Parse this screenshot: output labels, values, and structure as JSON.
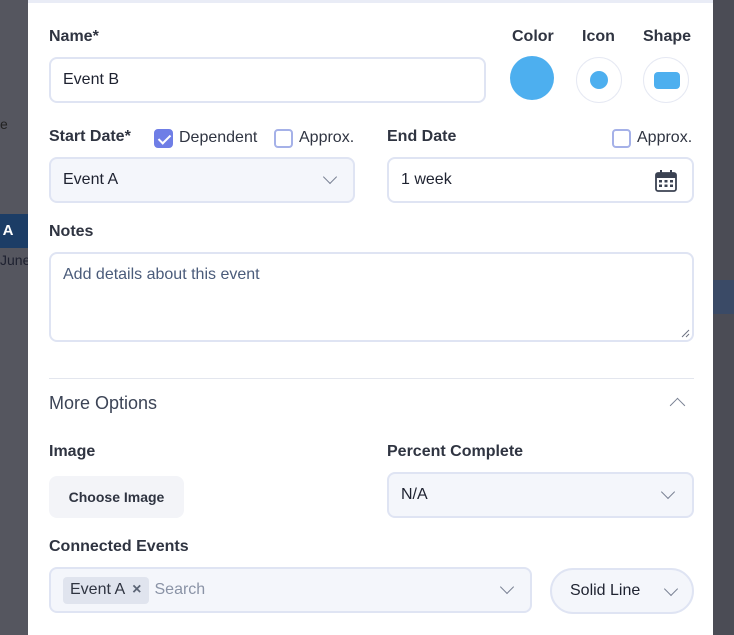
{
  "background": {
    "left_text_1": "e",
    "pill_text": "t A",
    "date_text": "June"
  },
  "form": {
    "name": {
      "label": "Name*",
      "value": "Event B"
    },
    "appearance": {
      "color_label": "Color",
      "icon_label": "Icon",
      "shape_label": "Shape",
      "color_value": "#4dafef"
    },
    "start_date": {
      "label": "Start Date*",
      "dependent_label": "Dependent",
      "dependent_checked": true,
      "approx_label": "Approx.",
      "approx_checked": false,
      "value": "Event A"
    },
    "end_date": {
      "label": "End Date",
      "approx_label": "Approx.",
      "approx_checked": false,
      "value": "1 week"
    },
    "notes": {
      "label": "Notes",
      "placeholder": "Add details about this event"
    },
    "more_options": {
      "title": "More Options",
      "image_label": "Image",
      "choose_image_label": "Choose Image",
      "percent_label": "Percent Complete",
      "percent_value": "N/A",
      "connected_label": "Connected Events",
      "connected_tag": "Event A",
      "connected_placeholder": "Search",
      "line_style_value": "Solid Line"
    }
  }
}
